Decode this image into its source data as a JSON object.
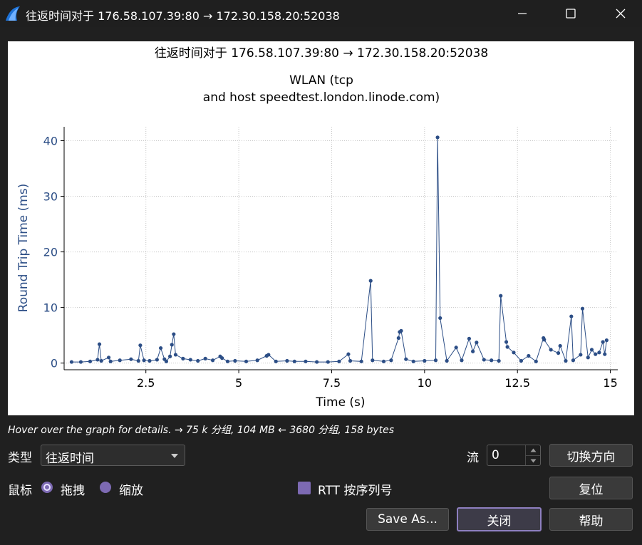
{
  "window": {
    "title": "往返时间对于 176.58.107.39:80 → 172.30.158.20:52038",
    "icon": "wireshark-fin-icon",
    "controls": [
      "minimize-icon",
      "maximize-icon",
      "close-icon"
    ]
  },
  "chart_data": {
    "type": "scatter",
    "title": "往返时间对于 176.58.107.39:80 → 172.30.158.20:52038",
    "subtitle_lines": [
      "WLAN (tcp",
      "and host speedtest.london.linode.com)"
    ],
    "xlabel": "Time (s)",
    "ylabel": "Round Trip Time (ms)",
    "xlim": [
      0.3,
      15.2
    ],
    "ylim": [
      -1.2,
      42.5
    ],
    "xticks": [
      2.5,
      5,
      7.5,
      10,
      12.5,
      15
    ],
    "xtick_labels": [
      "2.5",
      "5",
      "7.5",
      "10",
      "12.5",
      "15"
    ],
    "yticks": [
      0,
      10,
      20,
      30,
      40
    ],
    "ytick_labels": [
      "0",
      "10",
      "20",
      "30",
      "40"
    ],
    "grid": true,
    "color": "#2c4e86",
    "series": [
      {
        "x": [
          0.5,
          0.75,
          1.0,
          1.2,
          1.25,
          1.3,
          1.5,
          1.55,
          1.8,
          2.1,
          2.3,
          2.35,
          2.45,
          2.6,
          2.8,
          2.9,
          3.0,
          3.05,
          3.15,
          3.2,
          3.25,
          3.3,
          3.5,
          3.7,
          3.9,
          4.1,
          4.3,
          4.5,
          4.55,
          4.7,
          4.9,
          5.2,
          5.5,
          5.75,
          5.8,
          6.0,
          6.3,
          6.5,
          6.8,
          7.1,
          7.4,
          7.7,
          7.95,
          8.0,
          8.3,
          8.55,
          8.6,
          8.9,
          9.1,
          9.3,
          9.33,
          9.37,
          9.5,
          9.7,
          10.0,
          10.3,
          10.35,
          10.42,
          10.6,
          10.85,
          11.0,
          11.2,
          11.3,
          11.4,
          11.6,
          11.8,
          12.0,
          12.05,
          12.2,
          12.23,
          12.4,
          12.6,
          12.8,
          13.0,
          13.2,
          13.22,
          13.4,
          13.6,
          13.65,
          13.8,
          13.95,
          14.0,
          14.2,
          14.25,
          14.4,
          14.5,
          14.6,
          14.7,
          14.8,
          14.85,
          14.9
        ],
        "y": [
          0.2,
          0.2,
          0.3,
          0.6,
          3.4,
          0.4,
          1.0,
          0.3,
          0.5,
          0.7,
          0.4,
          3.2,
          0.5,
          0.4,
          0.6,
          2.7,
          0.7,
          0.3,
          1.2,
          3.3,
          5.2,
          1.5,
          0.8,
          0.6,
          0.4,
          0.8,
          0.5,
          1.2,
          0.9,
          0.3,
          0.4,
          0.3,
          0.5,
          1.3,
          1.5,
          0.3,
          0.4,
          0.3,
          0.3,
          0.2,
          0.2,
          0.3,
          1.6,
          0.4,
          0.3,
          14.8,
          0.5,
          0.3,
          0.5,
          4.5,
          5.6,
          5.8,
          0.7,
          0.3,
          0.4,
          0.5,
          40.6,
          8.1,
          0.4,
          2.8,
          0.5,
          4.4,
          2.1,
          3.7,
          0.6,
          0.5,
          0.4,
          12.1,
          3.8,
          2.9,
          1.9,
          0.4,
          1.3,
          0.3,
          4.5,
          4.2,
          2.4,
          1.8,
          3.1,
          0.4,
          8.4,
          0.5,
          1.5,
          9.8,
          1.0,
          2.4,
          1.6,
          1.9,
          3.8,
          1.6,
          4.1
        ]
      }
    ]
  },
  "hint": "Hover over the graph for details. → 75 k 分组, 104 MB ← 3680 分组, 158 bytes",
  "controls": {
    "type_label": "类型",
    "type_value": "往返时间",
    "stream_label": "流",
    "stream_value": "0",
    "switch_direction": "切换方向",
    "mouse_label": "鼠标",
    "drag_label": "拖拽",
    "zoom_label": "缩放",
    "rtt_label": "RTT 按序列号",
    "reset": "复位",
    "save_as": "Save As...",
    "close": "关闭",
    "help": "帮助"
  }
}
